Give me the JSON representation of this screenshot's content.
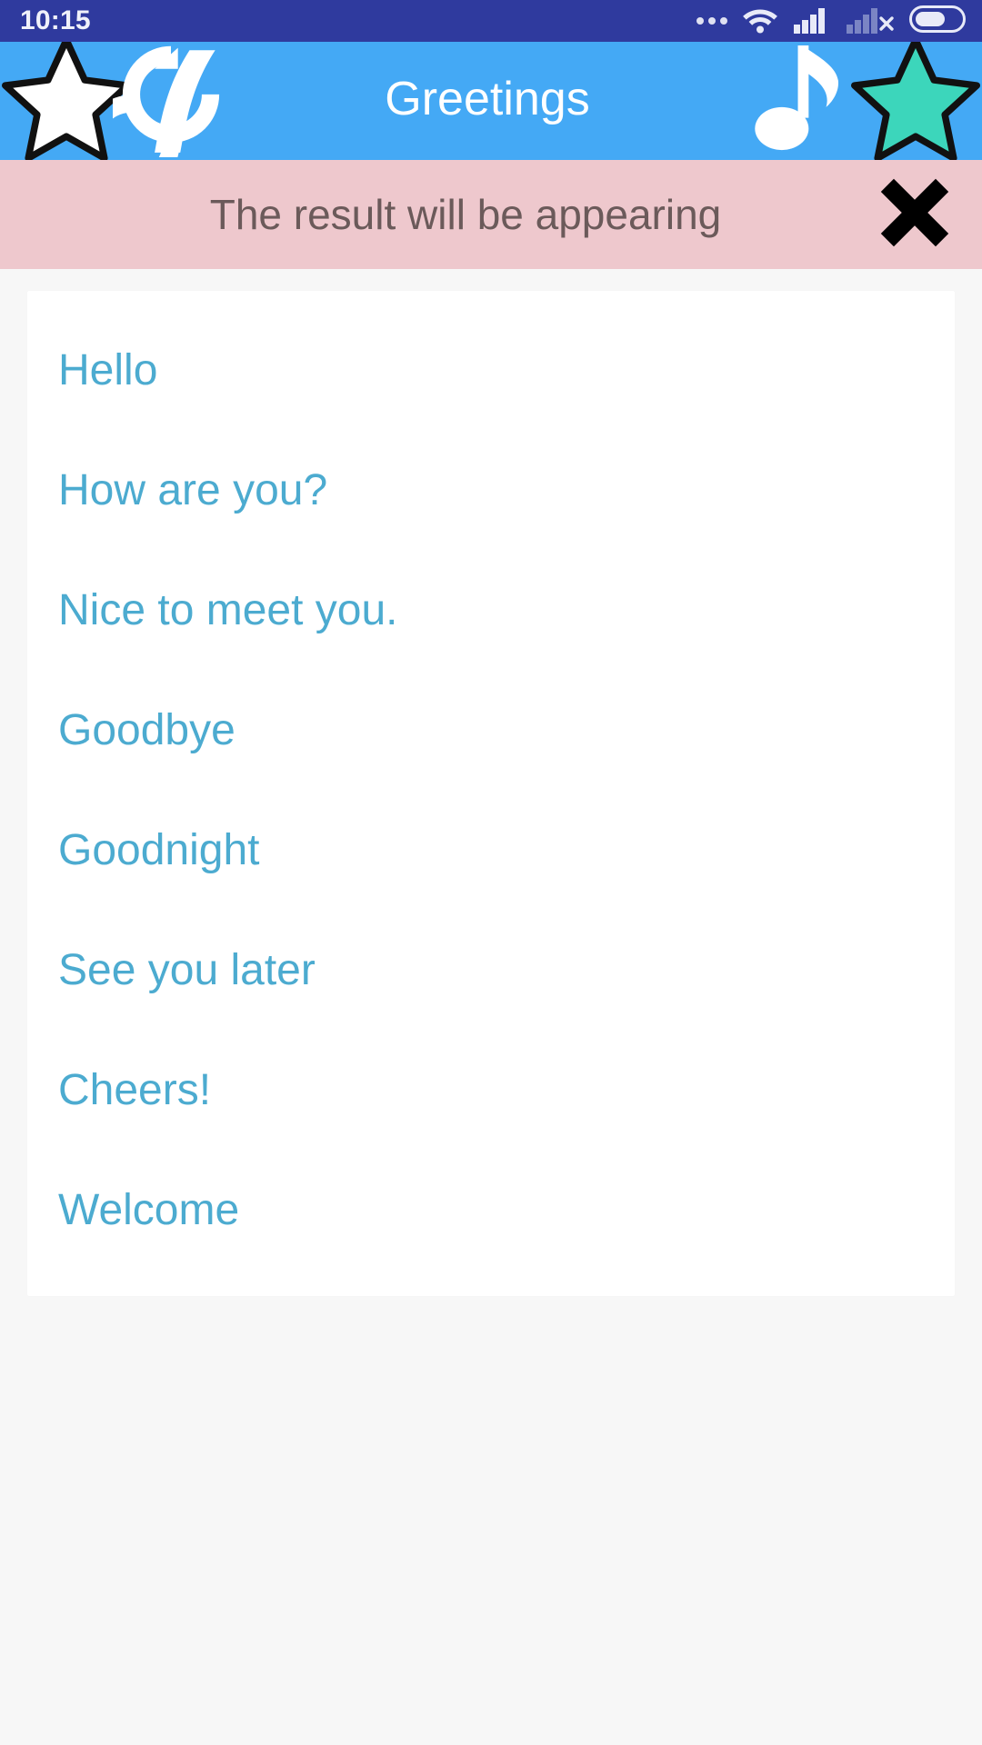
{
  "status_bar": {
    "time": "10:15",
    "icons": [
      {
        "name": "more-dots-icon"
      },
      {
        "name": "wifi-icon"
      },
      {
        "name": "cellular-signal-icon"
      },
      {
        "name": "cellular-signal-off-icon"
      },
      {
        "name": "battery-icon"
      }
    ],
    "background_color": "#2f3a9e"
  },
  "header": {
    "title": "Greetings",
    "background_color": "#44a9f5",
    "left_star_icon": "star-outline-icon",
    "swap_icon": "swap-refresh-icon",
    "music_note_icon": "music-note-icon",
    "right_star_icon": "star-filled-icon",
    "right_star_color": "#3cd6bb"
  },
  "result_banner": {
    "message": "The result will be appearing",
    "close_icon": "close-x-icon",
    "background_color": "#eec8cd",
    "text_color": "#6b5a5a"
  },
  "list": {
    "accent_color": "#4cabd0",
    "items": [
      {
        "label": "Hello"
      },
      {
        "label": "How are you?"
      },
      {
        "label": "Nice to meet you."
      },
      {
        "label": "Goodbye"
      },
      {
        "label": "Goodnight"
      },
      {
        "label": "See you later"
      },
      {
        "label": "Cheers!"
      },
      {
        "label": "Welcome"
      }
    ]
  }
}
